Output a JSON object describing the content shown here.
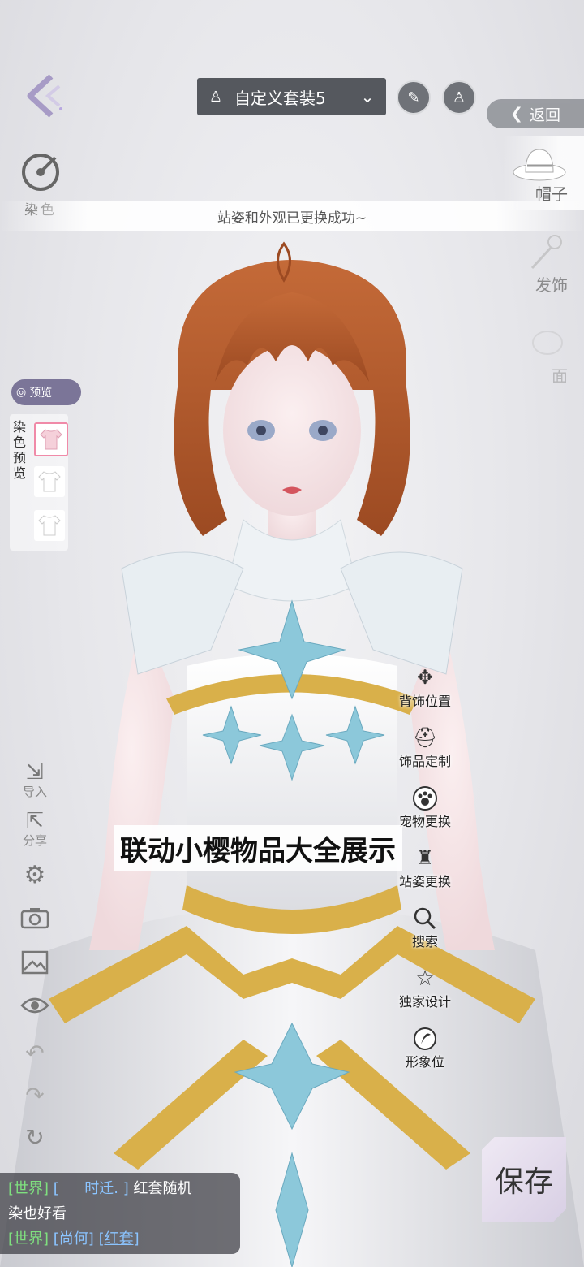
{
  "top_bar": {
    "outfit_name": "自定义套装5",
    "return_label": "返回"
  },
  "dye_tool": {
    "label": "染色"
  },
  "toast": {
    "message": "站姿和外观已更换成功~"
  },
  "categories": [
    {
      "name": "帽子",
      "active": true
    },
    {
      "name": "发饰",
      "active": false
    },
    {
      "name": "面",
      "active": false
    }
  ],
  "preview": {
    "pill_label": "预览",
    "panel_label": "染色预览"
  },
  "left_tools": {
    "import": "导入",
    "share": "分享"
  },
  "right_functions": [
    {
      "label": "背饰位置",
      "icon": "move-icon"
    },
    {
      "label": "饰品定制",
      "icon": "accessory-icon"
    },
    {
      "label": "宠物更换",
      "icon": "paw-icon"
    },
    {
      "label": "站姿更换",
      "icon": "pose-icon"
    },
    {
      "label": "搜索",
      "icon": "search-icon"
    },
    {
      "label": "独家设计",
      "icon": "star-icon"
    },
    {
      "label": "形象位",
      "icon": "avatar-slot-icon"
    }
  ],
  "caption": "联动小樱物品大全展示",
  "save_label": "保存",
  "chat": {
    "line1_channel": "[世界]",
    "line1_bracket_open": "[",
    "line1_name": "时迁.",
    "line1_bracket_close": "]",
    "line1_text": "红套随机",
    "line2_text": "染也好看",
    "line3_channel": "[世界]",
    "line3_name": "[尚何]",
    "line3_link": "[红套]"
  },
  "colors": {
    "hair": "#b45a2c",
    "dress": "#f4f4f6",
    "gold": "#d9b04a",
    "crystal": "#8cc8da",
    "topbar": "#55585e",
    "preview_pill": "#7b7598"
  }
}
